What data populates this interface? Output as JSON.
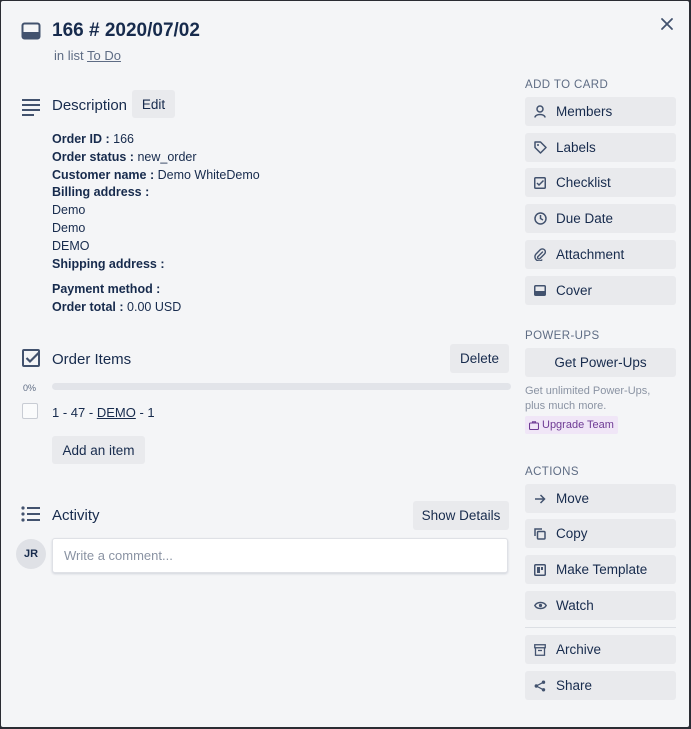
{
  "card": {
    "title": "166 # 2020/07/02",
    "in_list_prefix": "in list",
    "list_name": "To Do"
  },
  "description": {
    "heading": "Description",
    "edit_label": "Edit",
    "order_id_label": "Order ID :",
    "order_id_value": "166",
    "order_status_label": "Order status :",
    "order_status_value": "new_order",
    "customer_name_label": "Customer name :",
    "customer_name_value": "Demo WhiteDemo",
    "billing_address_label": "Billing address :",
    "billing_lines": [
      "Demo",
      "Demo",
      "DEMO"
    ],
    "shipping_address_label": "Shipping address :",
    "payment_method_label": "Payment method :",
    "order_total_label": "Order total :",
    "order_total_value": "0.00 USD"
  },
  "checklist": {
    "heading": "Order Items",
    "delete_label": "Delete",
    "percent_label": "0%",
    "progress": 0,
    "item_prefix": "1 - 47 -",
    "item_link": "DEMO",
    "item_suffix": "- 1",
    "add_item_label": "Add an item"
  },
  "activity": {
    "heading": "Activity",
    "show_details_label": "Show Details",
    "avatar_initials": "JR",
    "comment_placeholder": "Write a comment..."
  },
  "sidebar": {
    "add_to_card_heading": "ADD TO CARD",
    "add_to_card": [
      {
        "label": "Members",
        "icon": "person-icon"
      },
      {
        "label": "Labels",
        "icon": "tag-icon"
      },
      {
        "label": "Checklist",
        "icon": "checkbox-icon"
      },
      {
        "label": "Due Date",
        "icon": "clock-icon"
      },
      {
        "label": "Attachment",
        "icon": "paperclip-icon"
      },
      {
        "label": "Cover",
        "icon": "cover-icon"
      }
    ],
    "powerups_heading": "POWER-UPS",
    "get_powerups_label": "Get Power-Ups",
    "powerups_note_line1": "Get unlimited Power-Ups,",
    "powerups_note_line2": "plus much more.",
    "upgrade_label": "Upgrade Team",
    "actions_heading": "ACTIONS",
    "actions": [
      {
        "label": "Move",
        "icon": "arrow-right-icon"
      },
      {
        "label": "Copy",
        "icon": "copy-icon"
      },
      {
        "label": "Make Template",
        "icon": "template-icon"
      },
      {
        "label": "Watch",
        "icon": "eye-icon"
      }
    ],
    "archive_label": "Archive",
    "share_label": "Share"
  },
  "colors": {
    "modal_bg": "#f4f5f7",
    "button_bg": "#e9eaed",
    "text": "#172b4d",
    "muted": "#5e6c84",
    "upgrade_bg": "#f0e6f7",
    "upgrade_text": "#6e3b94"
  }
}
